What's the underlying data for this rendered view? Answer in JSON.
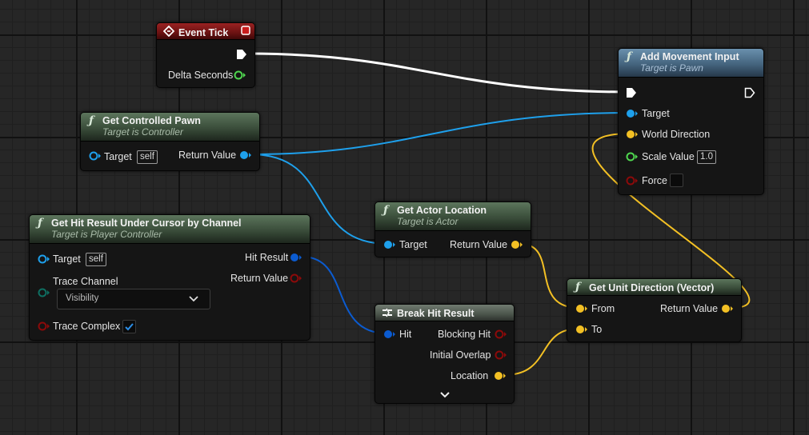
{
  "colors": {
    "exec": "#ffffff",
    "object": "#1ea0ec",
    "struct": "#f3c024",
    "float": "#4fd64f",
    "bool": "#8c0a0a",
    "byte": "#0e6f62",
    "hitresult": "#0b5bd0"
  },
  "nodes": {
    "event_tick": {
      "title": "Event Tick",
      "delta_seconds": "Delta Seconds"
    },
    "get_controlled_pawn": {
      "title": "Get Controlled Pawn",
      "subtitle": "Target is Controller",
      "target": "Target",
      "target_default": "self",
      "return_value": "Return Value"
    },
    "get_hit_result": {
      "title": "Get Hit Result Under Cursor by Channel",
      "subtitle": "Target is Player Controller",
      "target": "Target",
      "target_default": "self",
      "hit_result": "Hit Result",
      "return_value": "Return Value",
      "trace_channel": "Trace Channel",
      "trace_channel_value": "Visibility",
      "trace_complex": "Trace Complex",
      "trace_complex_checked": true
    },
    "get_actor_location": {
      "title": "Get Actor Location",
      "subtitle": "Target is Actor",
      "target": "Target",
      "return_value": "Return Value"
    },
    "break_hit_result": {
      "title": "Break Hit Result",
      "hit": "Hit",
      "blocking_hit": "Blocking Hit",
      "initial_overlap": "Initial Overlap",
      "location": "Location"
    },
    "get_unit_direction": {
      "title": "Get Unit Direction (Vector)",
      "from": "From",
      "to": "To",
      "return_value": "Return Value"
    },
    "add_movement_input": {
      "title": "Add Movement Input",
      "subtitle": "Target is Pawn",
      "target": "Target",
      "world_direction": "World Direction",
      "scale_value": "Scale Value",
      "scale_value_default": "1.0",
      "force": "Force"
    }
  }
}
